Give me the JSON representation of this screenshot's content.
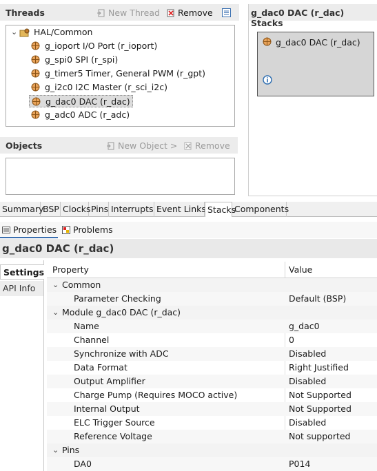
{
  "threads": {
    "title": "Threads",
    "new_thread_label": "New Thread",
    "remove_label": "Remove",
    "root_label": "HAL/Common",
    "items": [
      "g_ioport I/O Port (r_ioport)",
      "g_spi0 SPI (r_spi)",
      "g_timer5 Timer, General PWM (r_gpt)",
      "g_i2c0 I2C Master (r_sci_i2c)",
      "g_dac0 DAC (r_dac)",
      "g_adc0 ADC (r_adc)"
    ],
    "selected_index": 4
  },
  "objects": {
    "title": "Objects",
    "new_object_label": "New Object >",
    "remove_label": "Remove"
  },
  "stacks": {
    "title": "g_dac0 DAC (r_dac) Stacks",
    "block_label": "g_dac0 DAC (r_dac)"
  },
  "config_tabs": [
    "Summary",
    "BSP",
    "Clocks",
    "Pins",
    "Interrupts",
    "Event Links",
    "Stacks",
    "Components"
  ],
  "active_config_tab": "Stacks",
  "views": {
    "properties_label": "Properties",
    "problems_label": "Problems"
  },
  "properties": {
    "title": "g_dac0 DAC (r_dac)",
    "side_tabs": [
      "Settings",
      "API Info"
    ],
    "columns": {
      "property": "Property",
      "value": "Value"
    },
    "rows": [
      {
        "label": "Common",
        "value": "",
        "level": 0,
        "section": true
      },
      {
        "label": "Parameter Checking",
        "value": "Default (BSP)",
        "level": 1
      },
      {
        "label": "Module g_dac0 DAC (r_dac)",
        "value": "",
        "level": 0,
        "section": true
      },
      {
        "label": "Name",
        "value": "g_dac0",
        "level": 1
      },
      {
        "label": "Channel",
        "value": "0",
        "level": 1
      },
      {
        "label": "Synchronize with ADC",
        "value": "Disabled",
        "level": 1
      },
      {
        "label": "Data Format",
        "value": "Right Justified",
        "level": 1
      },
      {
        "label": "Output Amplifier",
        "value": "Disabled",
        "level": 1
      },
      {
        "label": "Charge Pump (Requires MOCO active)",
        "value": "Not Supported",
        "level": 1
      },
      {
        "label": "Internal Output",
        "value": "Not Supported",
        "level": 1
      },
      {
        "label": "ELC Trigger Source",
        "value": "Disabled",
        "level": 1
      },
      {
        "label": "Reference Voltage",
        "value": "Not supported",
        "level": 1
      },
      {
        "label": "Pins",
        "value": "",
        "level": 0,
        "section": true
      },
      {
        "label": "DA0",
        "value": "P014",
        "level": 1
      }
    ]
  },
  "colors": {
    "panel_header_bg": "#ececec",
    "selection_bg": "#dcdcdc",
    "component_icon": "#c07a2a",
    "info_icon": "#2b6cb0"
  }
}
